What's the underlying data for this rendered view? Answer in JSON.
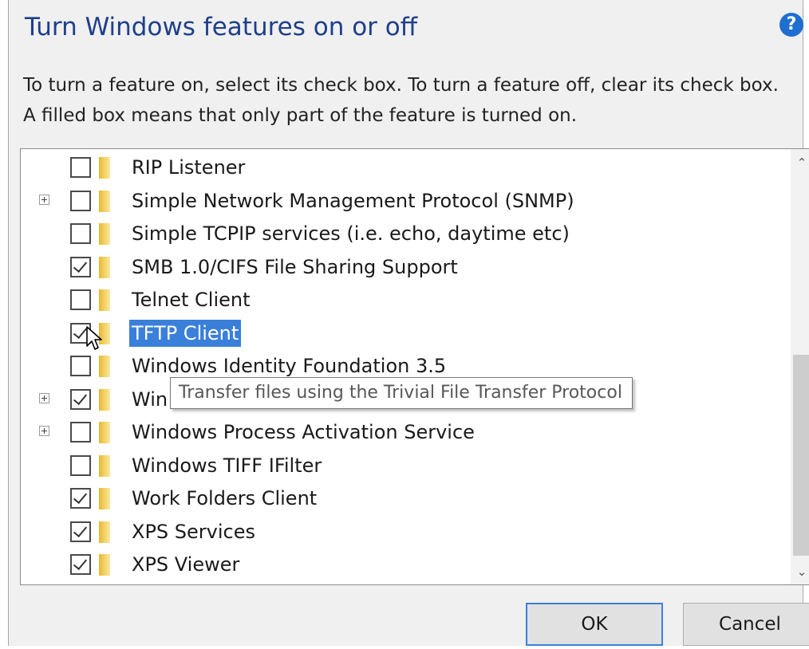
{
  "dialog": {
    "title": "Turn Windows features on or off",
    "help_icon": "help-icon",
    "description": "To turn a feature on, select its check box. To turn a feature off, clear its check box. A filled box means that only part of the feature is turned on."
  },
  "features": [
    {
      "label": "RIP Listener",
      "checked": false,
      "expandable": false,
      "selected": false
    },
    {
      "label": "Simple Network Management Protocol (SNMP)",
      "checked": false,
      "expandable": true,
      "selected": false
    },
    {
      "label": "Simple TCPIP services (i.e. echo, daytime etc)",
      "checked": false,
      "expandable": false,
      "selected": false
    },
    {
      "label": "SMB 1.0/CIFS File Sharing Support",
      "checked": true,
      "expandable": false,
      "selected": false
    },
    {
      "label": "Telnet Client",
      "checked": false,
      "expandable": false,
      "selected": false
    },
    {
      "label": "TFTP Client",
      "checked": true,
      "expandable": false,
      "selected": true
    },
    {
      "label": "Windows Identity Foundation 3.5",
      "checked": false,
      "expandable": false,
      "selected": false
    },
    {
      "label": "Win",
      "checked": true,
      "expandable": true,
      "selected": false
    },
    {
      "label": "Windows Process Activation Service",
      "checked": false,
      "expandable": true,
      "selected": false
    },
    {
      "label": "Windows TIFF IFilter",
      "checked": false,
      "expandable": false,
      "selected": false
    },
    {
      "label": "Work Folders Client",
      "checked": true,
      "expandable": false,
      "selected": false
    },
    {
      "label": "XPS Services",
      "checked": true,
      "expandable": false,
      "selected": false
    },
    {
      "label": "XPS Viewer",
      "checked": true,
      "expandable": false,
      "selected": false
    }
  ],
  "tooltip": {
    "text": "Transfer files using the Trivial File Transfer Protocol"
  },
  "buttons": {
    "ok": "OK",
    "cancel": "Cancel"
  },
  "colors": {
    "title": "#1e3f8a",
    "selection": "#3a7fd9",
    "help": "#1f6fd1",
    "folder": "#f4d46a"
  }
}
